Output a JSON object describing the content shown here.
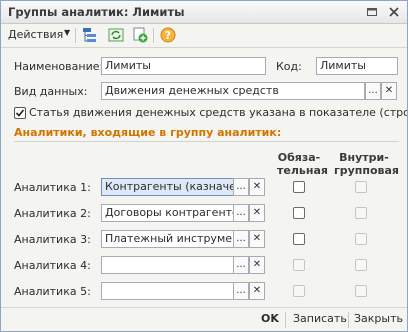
{
  "window": {
    "title": "Группы аналитик: Лимиты"
  },
  "toolbar": {
    "actions_label": "Действия"
  },
  "form": {
    "name_label": "Наименование:",
    "name_value": "Лимиты",
    "code_label": "Код:",
    "code_value": "Лимиты",
    "data_type_label": "Вид данных:",
    "data_type_value": "Движения денежных средств",
    "checkbox_label": "Статья движения денежных средств указана в показателе (строке)",
    "checkbox_checked": true
  },
  "section": {
    "title": "Аналитики, входящие в группу аналитик:",
    "col_required": [
      "Обяза-",
      "тельная"
    ],
    "col_intragroup": [
      "Внутри-",
      "групповая"
    ]
  },
  "analytics": [
    {
      "label": "Аналитика 1:",
      "value": "Контрагенты (казначейс",
      "required": false,
      "intragroup": false,
      "selected": true
    },
    {
      "label": "Аналитика 2:",
      "value": "Договоры контрагентов",
      "required": false,
      "intragroup": false,
      "selected": false
    },
    {
      "label": "Аналитика 3:",
      "value": "Платежный инструмент (",
      "required": false,
      "intragroup": false,
      "selected": false
    },
    {
      "label": "Аналитика 4:",
      "value": "",
      "required": false,
      "intragroup": false,
      "selected": false
    },
    {
      "label": "Аналитика 5:",
      "value": "",
      "required": false,
      "intragroup": false,
      "selected": false
    }
  ],
  "buttons": {
    "ok": "OK",
    "save": "Записать",
    "close": "Закрыть",
    "ellipsis": "...",
    "clear": "✕"
  }
}
